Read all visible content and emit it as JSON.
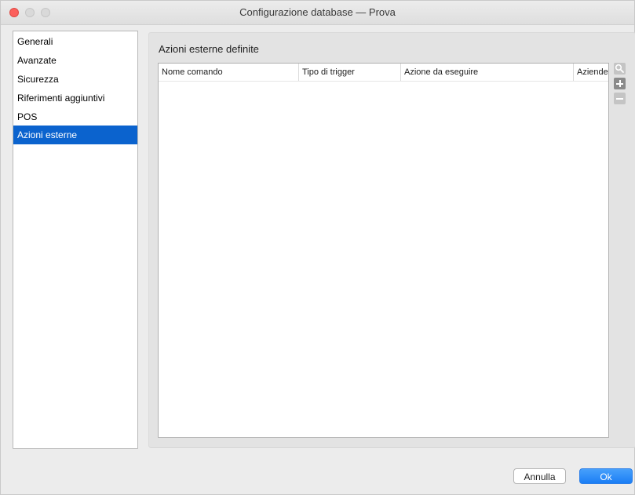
{
  "window": {
    "title": "Configurazione database — Prova"
  },
  "sidebar": {
    "items": [
      {
        "label": "Generali",
        "selected": false
      },
      {
        "label": "Avanzate",
        "selected": false
      },
      {
        "label": "Sicurezza",
        "selected": false
      },
      {
        "label": "Riferimenti aggiuntivi",
        "selected": false
      },
      {
        "label": "POS",
        "selected": false
      },
      {
        "label": "Azioni esterne",
        "selected": true
      }
    ]
  },
  "main": {
    "section_title": "Azioni esterne definite",
    "table": {
      "columns": [
        "Nome comando",
        "Tipo di trigger",
        "Azione da eseguire",
        "Aziende"
      ],
      "rows": []
    },
    "side_buttons": [
      "search-icon",
      "plus-icon",
      "minus-icon"
    ]
  },
  "footer": {
    "cancel_label": "Annulla",
    "ok_label": "Ok"
  },
  "colors": {
    "accent": "#0b63ce",
    "close": "#fc605c"
  }
}
